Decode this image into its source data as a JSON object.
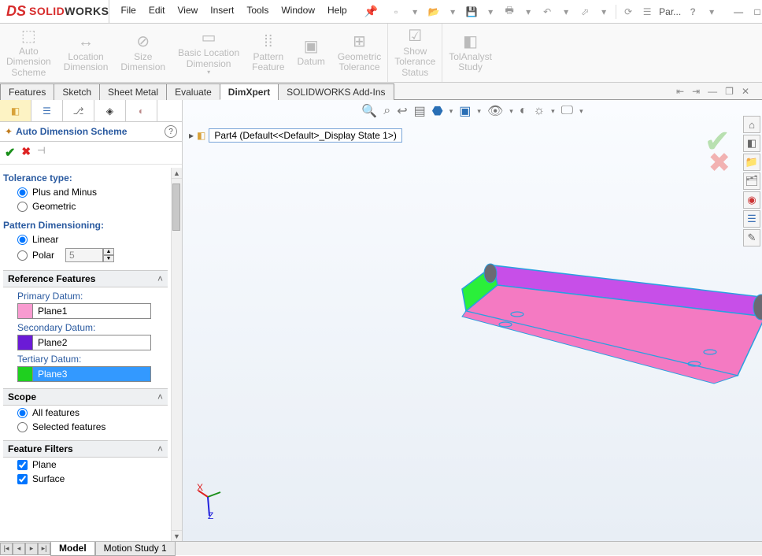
{
  "app": {
    "logo_ds": "DS",
    "logo1": "SOLID",
    "logo2": "WORKS"
  },
  "menu": [
    "File",
    "Edit",
    "View",
    "Insert",
    "Tools",
    "Window",
    "Help"
  ],
  "title_toolbar": {
    "doc_label": "Par..."
  },
  "ribbon": [
    {
      "l1": "Auto",
      "l2": "Dimension",
      "l3": "Scheme"
    },
    {
      "l1": "Location",
      "l2": "Dimension",
      "l3": ""
    },
    {
      "l1": "Size",
      "l2": "Dimension",
      "l3": ""
    },
    {
      "l1": "Basic Location",
      "l2": "Dimension",
      "l3": ""
    },
    {
      "l1": "Pattern",
      "l2": "Feature",
      "l3": ""
    },
    {
      "l1": "Datum",
      "l2": "",
      "l3": ""
    },
    {
      "l1": "Geometric",
      "l2": "Tolerance",
      "l3": ""
    },
    {
      "l1": "Show",
      "l2": "Tolerance",
      "l3": "Status"
    },
    {
      "l1": "TolAnalyst",
      "l2": "Study",
      "l3": ""
    }
  ],
  "tabs": [
    "Features",
    "Sketch",
    "Sheet Metal",
    "Evaluate",
    "DimXpert",
    "SOLIDWORKS Add-Ins"
  ],
  "active_tab": "DimXpert",
  "panel": {
    "title": "Auto Dimension Scheme",
    "tol_label": "Tolerance type:",
    "tol_opts": [
      "Plus and Minus",
      "Geometric"
    ],
    "pat_label": "Pattern Dimensioning:",
    "pat_opts": [
      "Linear",
      "Polar"
    ],
    "polar_value": "5",
    "ref_group": "Reference Features",
    "primary_label": "Primary Datum:",
    "primary_value": "Plane1",
    "secondary_label": "Secondary Datum:",
    "secondary_value": "Plane2",
    "tertiary_label": "Tertiary Datum:",
    "tertiary_value": "Plane3",
    "scope_group": "Scope",
    "scope_opts": [
      "All features",
      "Selected features"
    ],
    "filter_group": "Feature Filters",
    "filter_opts": [
      "Plane",
      "Surface"
    ]
  },
  "breadcrumb": "Part4  (Default<<Default>_Display State 1>)",
  "bottom_tabs": [
    "Model",
    "Motion Study 1"
  ],
  "triad": {
    "x": "X",
    "z": "Z"
  },
  "colors": {
    "primary_swatch": "#f89bd0",
    "secondary_swatch": "#6b1bd6",
    "tertiary_swatch": "#1fd01f"
  }
}
